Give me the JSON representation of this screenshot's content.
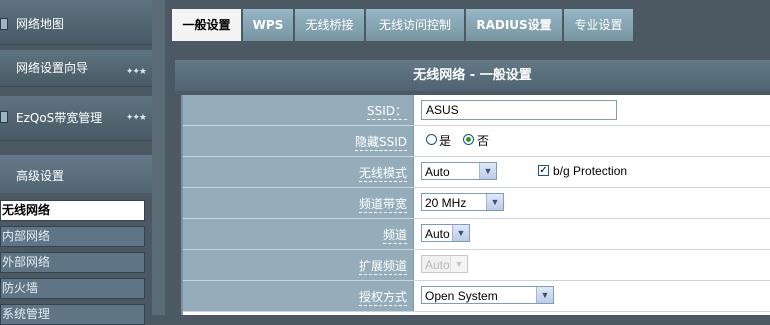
{
  "sidebar": {
    "main_items": [
      {
        "label": "网络地图"
      },
      {
        "label": "网络设置向导"
      },
      {
        "label": "EzQoS带宽管理"
      }
    ],
    "advanced_label": "高级设置",
    "sub_items": [
      {
        "label": "无线网络"
      },
      {
        "label": "内部网络"
      },
      {
        "label": "外部网络"
      },
      {
        "label": "防火墙"
      },
      {
        "label": "系统管理"
      }
    ]
  },
  "tabs": [
    {
      "label": "一般设置"
    },
    {
      "label": "WPS"
    },
    {
      "label": "无线桥接"
    },
    {
      "label": "无线访问控制"
    },
    {
      "label": "RADIUS设置"
    },
    {
      "label": "专业设置"
    }
  ],
  "page": {
    "title": "无线网络 - 一般设置"
  },
  "form": {
    "ssid": {
      "label": "SSID：",
      "value": "ASUS"
    },
    "hide_ssid": {
      "label": "隐藏SSID",
      "yes": "是",
      "no": "否",
      "selected": "no"
    },
    "wireless_mode": {
      "label": "无线模式",
      "value": "Auto",
      "bg_protection_label": "b/g Protection",
      "bg_protection_checked": true
    },
    "channel_bandwidth": {
      "label": "频道带宽",
      "value": "20 MHz"
    },
    "channel": {
      "label": "频道",
      "value": "Auto"
    },
    "extension_channel": {
      "label": "扩展频道",
      "value": "Auto"
    },
    "auth_method": {
      "label": "授权方式",
      "value": "Open System"
    }
  },
  "colors": {
    "background": "#4c5963",
    "label_cell": "#95adbb",
    "tab_active": "#f4f4f4",
    "radio_selected": "#21a121"
  },
  "icons": {
    "menu_stars": "stars-icon",
    "dropdown": "chevron-down-icon"
  }
}
